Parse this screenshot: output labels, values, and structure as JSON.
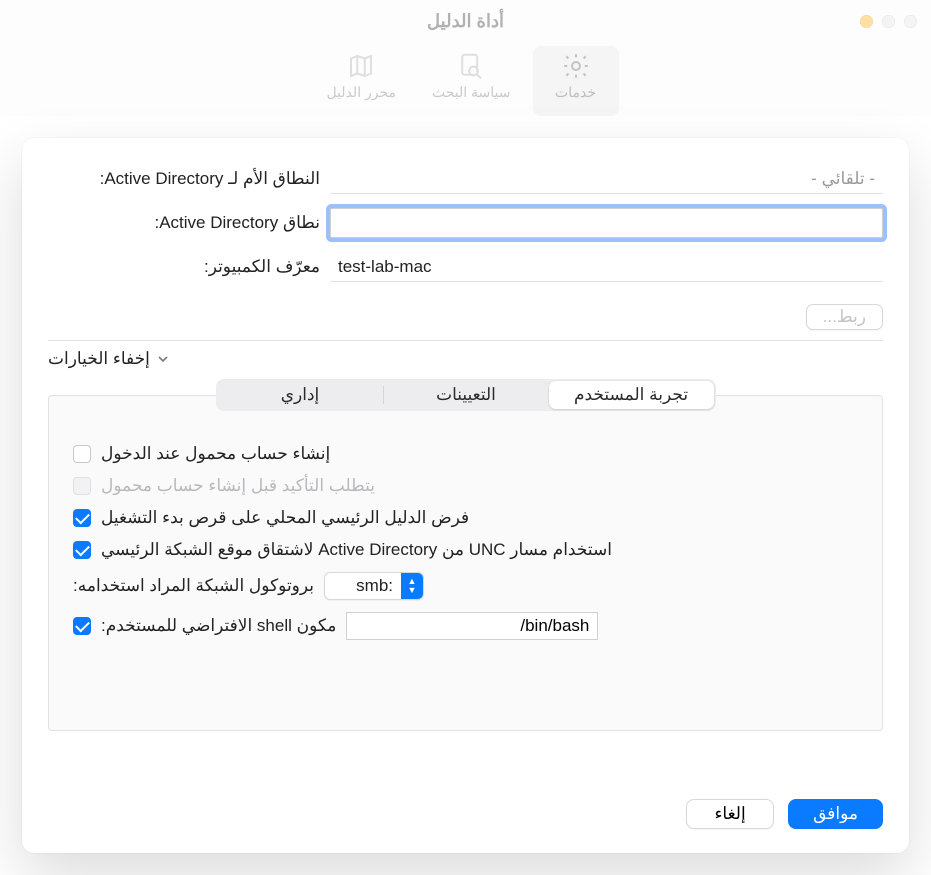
{
  "window": {
    "title": "أداة الدليل"
  },
  "toolbar": {
    "services": "خدمات",
    "search_policy": "سياسة البحث",
    "directory_editor": "محرر الدليل"
  },
  "form": {
    "forest_label": "النطاق الأم لـ Active Directory:",
    "forest_value": "- تلقائي -",
    "domain_label": "نطاق Active Directory:",
    "domain_value": "",
    "computer_label": "معرّف الكمبيوتر:",
    "computer_value": "test-lab-mac",
    "bind_button": "ربط..."
  },
  "options_toggle": "إخفاء الخيارات",
  "tabs": {
    "user_experience": "تجربة المستخدم",
    "mappings": "التعيينات",
    "administrative": "إداري"
  },
  "options": {
    "mobile_account": "إنشاء حساب محمول عند الدخول",
    "confirm_mobile": "يتطلب التأكيد قبل إنشاء حساب محمول",
    "force_local_home": "فرض الدليل الرئيسي المحلي على قرص بدء التشغيل",
    "use_unc": "استخدام مسار UNC من Active Directory لاشتقاق موقع الشبكة الرئيسي",
    "protocol_label": "بروتوكول الشبكة المراد استخدامه:",
    "protocol_value": "smb:",
    "default_shell_label": "مكون shell الافتراضي للمستخدم:",
    "default_shell_value": "/bin/bash"
  },
  "footer": {
    "cancel": "إلغاء",
    "ok": "موافق"
  }
}
